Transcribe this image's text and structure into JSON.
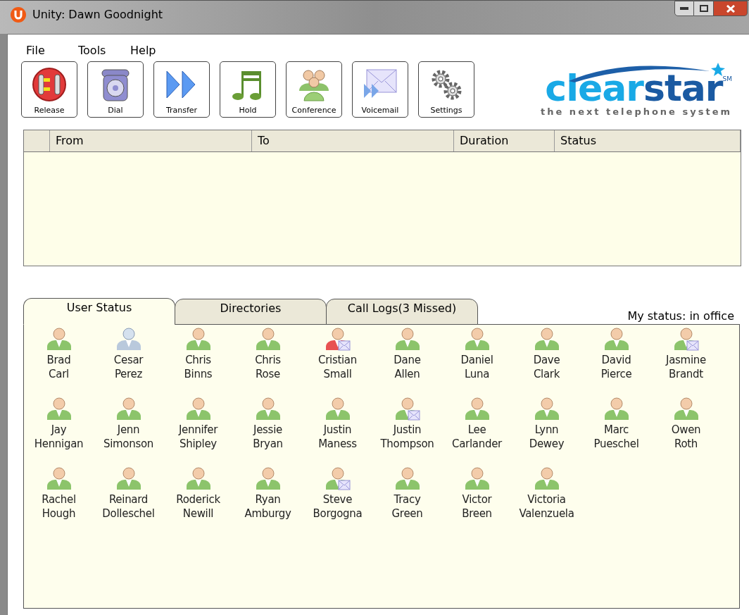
{
  "window": {
    "title": "Unity: Dawn Goodnight"
  },
  "menu": [
    "File",
    "Tools",
    "Help"
  ],
  "toolbar": [
    {
      "label": "Release",
      "kind": "release"
    },
    {
      "label": "Dial",
      "kind": "dial"
    },
    {
      "label": "Transfer",
      "kind": "transfer"
    },
    {
      "label": "Hold",
      "kind": "hold"
    },
    {
      "label": "Conference",
      "kind": "conference"
    },
    {
      "label": "Voicemail",
      "kind": "voicemail"
    },
    {
      "label": "Settings",
      "kind": "settings"
    }
  ],
  "logo": {
    "text_light": "clear",
    "text_dark": "star",
    "service_mark": "SM",
    "tagline": "the next telephone system"
  },
  "calls_table": {
    "columns": [
      "From",
      "To",
      "Duration",
      "Status"
    ]
  },
  "tabs": [
    {
      "label": "User Status",
      "selected": true
    },
    {
      "label": "Directories",
      "selected": false
    },
    {
      "label": "Call Logs(3 Missed)",
      "selected": false
    }
  ],
  "my_status": "My status: in office",
  "users": [
    {
      "first": "Brad",
      "last": "Carl",
      "kind": "available",
      "voicemail": false
    },
    {
      "first": "Cesar",
      "last": "Perez",
      "kind": "offline",
      "voicemail": false
    },
    {
      "first": "Chris",
      "last": "Binns",
      "kind": "available",
      "voicemail": false
    },
    {
      "first": "Chris",
      "last": "Rose",
      "kind": "available",
      "voicemail": false
    },
    {
      "first": "Cristian",
      "last": "Small",
      "kind": "busy",
      "voicemail": true
    },
    {
      "first": "Dane",
      "last": "Allen",
      "kind": "available",
      "voicemail": false
    },
    {
      "first": "Daniel",
      "last": "Luna",
      "kind": "available",
      "voicemail": false
    },
    {
      "first": "Dave",
      "last": "Clark",
      "kind": "available",
      "voicemail": false
    },
    {
      "first": "David",
      "last": "Pierce",
      "kind": "available",
      "voicemail": false
    },
    {
      "first": "Jasmine",
      "last": "Brandt",
      "kind": "available",
      "voicemail": true
    },
    {
      "first": "Jay",
      "last": "Hennigan",
      "kind": "available",
      "voicemail": false
    },
    {
      "first": "Jenn",
      "last": "Simonson",
      "kind": "available",
      "voicemail": false
    },
    {
      "first": "Jennifer",
      "last": "Shipley",
      "kind": "available",
      "voicemail": false
    },
    {
      "first": "Jessie",
      "last": "Bryan",
      "kind": "available",
      "voicemail": false
    },
    {
      "first": "Justin",
      "last": "Maness",
      "kind": "available",
      "voicemail": false
    },
    {
      "first": "Justin",
      "last": "Thompson",
      "kind": "available",
      "voicemail": true
    },
    {
      "first": "Lee",
      "last": "Carlander",
      "kind": "available",
      "voicemail": false
    },
    {
      "first": "Lynn",
      "last": "Dewey",
      "kind": "available",
      "voicemail": false
    },
    {
      "first": "Marc",
      "last": "Pueschel",
      "kind": "available",
      "voicemail": false
    },
    {
      "first": "Owen",
      "last": "Roth",
      "kind": "available",
      "voicemail": false
    },
    {
      "first": "Rachel",
      "last": "Hough",
      "kind": "available",
      "voicemail": false
    },
    {
      "first": "Reinard",
      "last": "Dolleschel",
      "kind": "available",
      "voicemail": false
    },
    {
      "first": "Roderick",
      "last": "Newill",
      "kind": "available",
      "voicemail": false
    },
    {
      "first": "Ryan",
      "last": "Amburgy",
      "kind": "available",
      "voicemail": false
    },
    {
      "first": "Steve",
      "last": "Borgogna",
      "kind": "available",
      "voicemail": true
    },
    {
      "first": "Tracy",
      "last": "Green",
      "kind": "available",
      "voicemail": false
    },
    {
      "first": "Victor",
      "last": "Breen",
      "kind": "available",
      "voicemail": false
    },
    {
      "first": "Victoria",
      "last": "Valenzuela",
      "kind": "available",
      "voicemail": false
    }
  ]
}
